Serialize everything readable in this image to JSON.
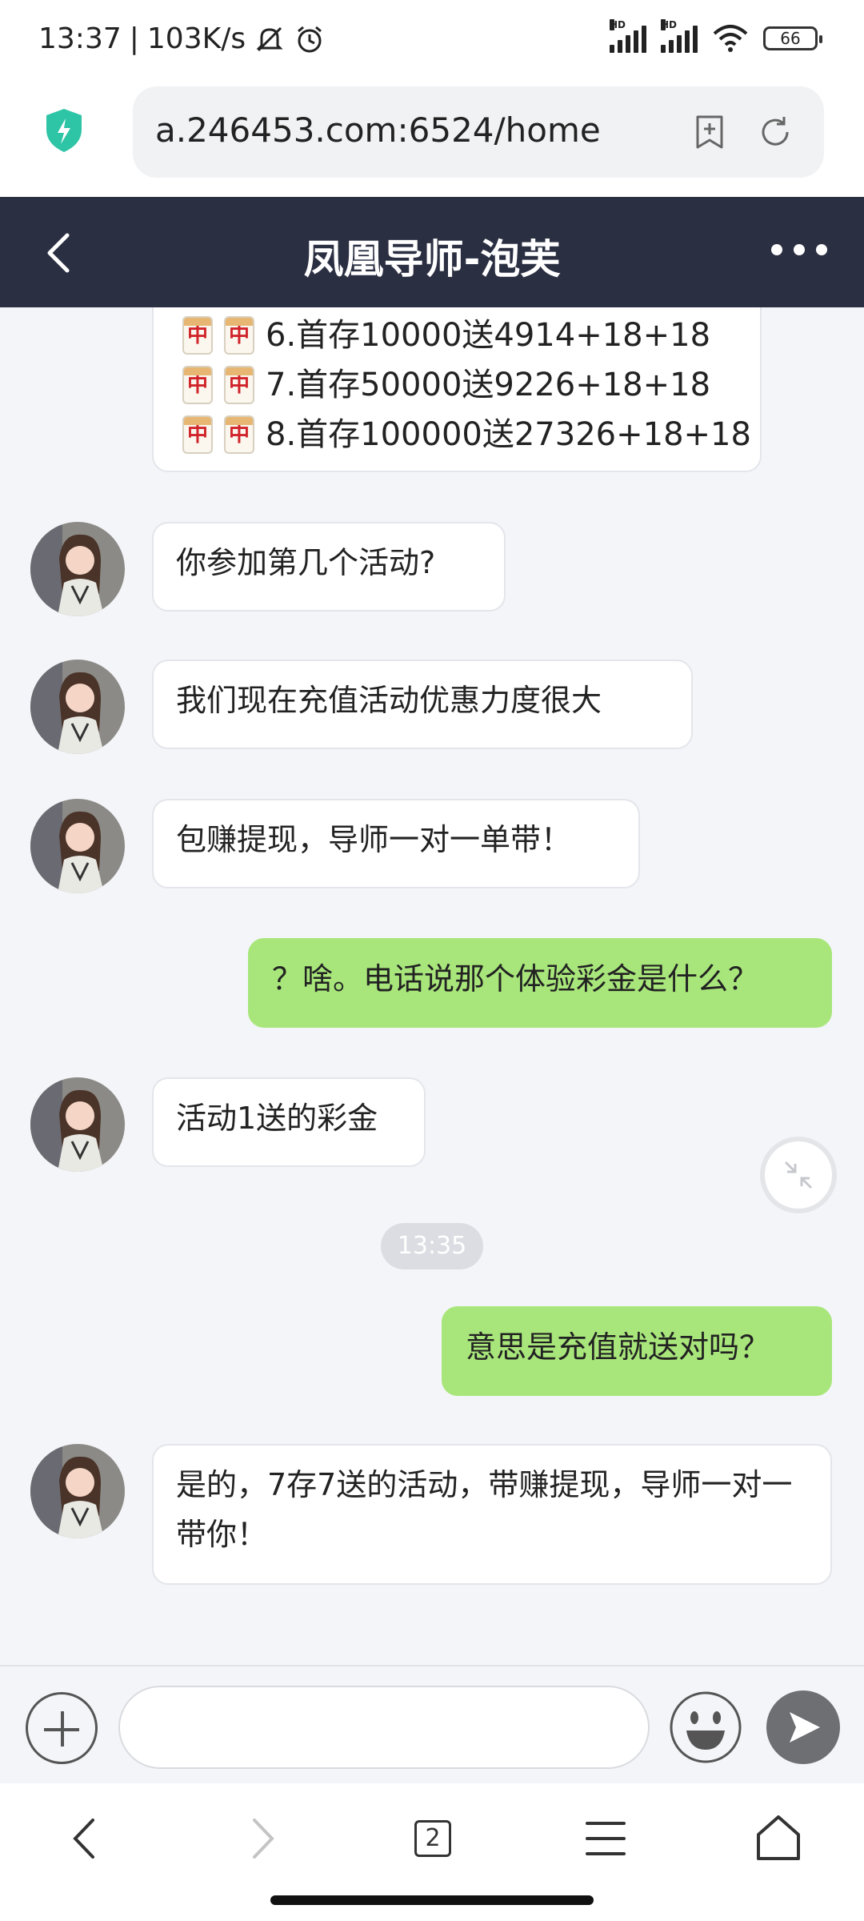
{
  "status_bar": {
    "time": "13:37",
    "net_speed": "103K/s",
    "battery": "66",
    "hd_label": "HD"
  },
  "browser": {
    "url": "a.246453.com:6524/home",
    "tab_count": "2"
  },
  "header": {
    "title": "凤凰导师-泡芙"
  },
  "promo": {
    "tile_char": "中",
    "lines": [
      "6.首存10000送4914+18+18",
      "7.首存50000送9226+18+18",
      "8.首存100000送27326+18+18"
    ]
  },
  "messages": [
    {
      "from": "them",
      "text": "你参加第几个活动?"
    },
    {
      "from": "them",
      "text": "我们现在充值活动优惠力度很大"
    },
    {
      "from": "them",
      "text": "包赚提现，导师一对一单带！"
    },
    {
      "from": "me",
      "text": "？啥。电话说那个体验彩金是什么？"
    },
    {
      "from": "them",
      "text": "活动1送的彩金"
    },
    {
      "from": "me",
      "text": "意思是充值就送对吗？"
    },
    {
      "from": "them",
      "text": "是的，7存7送的活动，带赚提现，导师一对一带你！"
    }
  ],
  "timestamp_chip": "13:35",
  "colors": {
    "header_bg": "#2b2f42",
    "my_bubble": "#a8e67b",
    "their_bubble": "#ffffff",
    "chat_bg": "#f4f5f9"
  },
  "icons": {
    "back": "chevron-left-icon",
    "more": "more-dots-icon",
    "shield": "shield-icon",
    "bookmark": "bookmark-add-icon",
    "refresh": "refresh-icon",
    "plus": "plus-icon",
    "emoji": "emoji-icon",
    "send": "send-icon"
  }
}
